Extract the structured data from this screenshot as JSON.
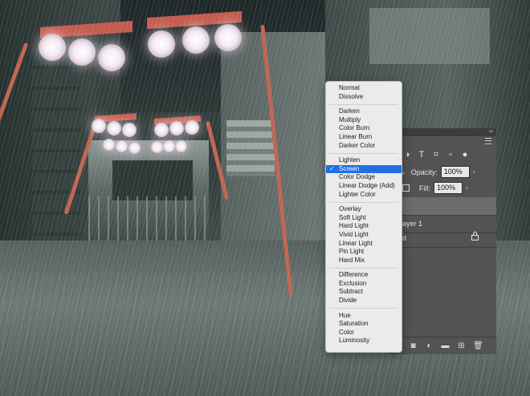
{
  "blend_menu": {
    "selected": "Screen",
    "groups": [
      [
        "Normal",
        "Dissolve"
      ],
      [
        "Darken",
        "Multiply",
        "Color Burn",
        "Linear Burn",
        "Darker Color"
      ],
      [
        "Lighten",
        "Screen",
        "Color Dodge",
        "Linear Dodge (Add)",
        "Lighter Color"
      ],
      [
        "Overlay",
        "Soft Light",
        "Hard Light",
        "Vivid Light",
        "Linear Light",
        "Pin Light",
        "Hard Mix"
      ],
      [
        "Difference",
        "Exclusion",
        "Subtract",
        "Divide"
      ],
      [
        "Hue",
        "Saturation",
        "Color",
        "Luminosity"
      ]
    ],
    "check_glyph": "✓",
    "highlight_color": "#1f6fe5"
  },
  "layers_panel": {
    "collapse_glyph": "‹‹",
    "opacity_label": "Opacity:",
    "opacity_value": "100%",
    "fill_label": "Fill:",
    "fill_value": "100%",
    "filter_icons": [
      "adjustment-filter-icon",
      "type-filter-icon",
      "shape-filter-icon",
      "smart-object-filter-icon",
      "toggle-filter-icon"
    ],
    "layers": [
      {
        "name": ""
      },
      {
        "name": "ayer 1"
      },
      {
        "name": "d"
      }
    ],
    "bottom_icons": [
      "add-mask-icon",
      "adjustment-layer-icon",
      "group-folder-icon",
      "new-layer-icon",
      "trash-icon"
    ]
  }
}
